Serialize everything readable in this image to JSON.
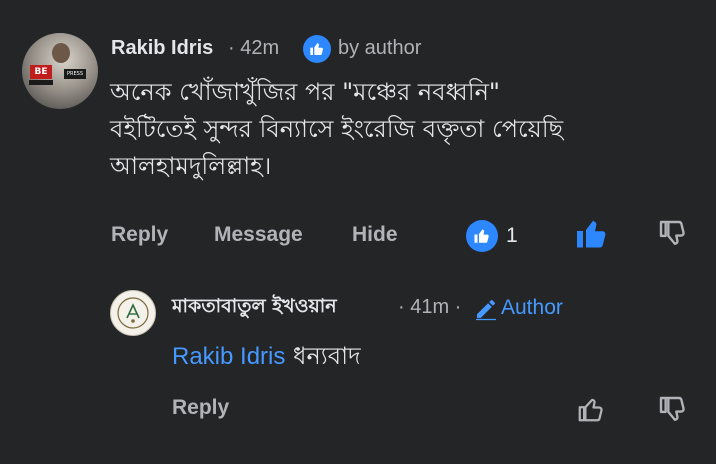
{
  "comment": {
    "author": "Rakib Idris",
    "time": "· 42m",
    "author_badge": "by author",
    "avatar_badge": "BE",
    "avatar_press": "PRESS",
    "lines": [
      "অনেক খোঁজাখুঁজির পর \"মঞ্চের নবধ্বনি\"",
      "বইটিতেই সুন্দর বিন্যাসে ইংরেজি বক্তৃতা পেয়েছি",
      "আলহামদুলিল্লাহ।"
    ],
    "actions": {
      "reply": "Reply",
      "message": "Message",
      "hide": "Hide"
    },
    "reaction_count": "1"
  },
  "reply": {
    "author": "মাকতাবাতুল ইখওয়ান",
    "time": "· 41m ·",
    "author_label": "Author",
    "mention": "Rakib Idris",
    "text": " ধন্যবাদ",
    "actions": {
      "reply": "Reply"
    }
  },
  "colors": {
    "background": "#242526",
    "primary_text": "#e4e6eb",
    "secondary_text": "#b0b3b8",
    "accent_blue": "#2d88ff",
    "link_blue": "#4599ff"
  },
  "icons": {
    "badge": "thumbs-up-badge-icon",
    "like": "thumbs-up-icon",
    "dislike": "thumbs-down-icon",
    "edit": "pencil-icon"
  }
}
